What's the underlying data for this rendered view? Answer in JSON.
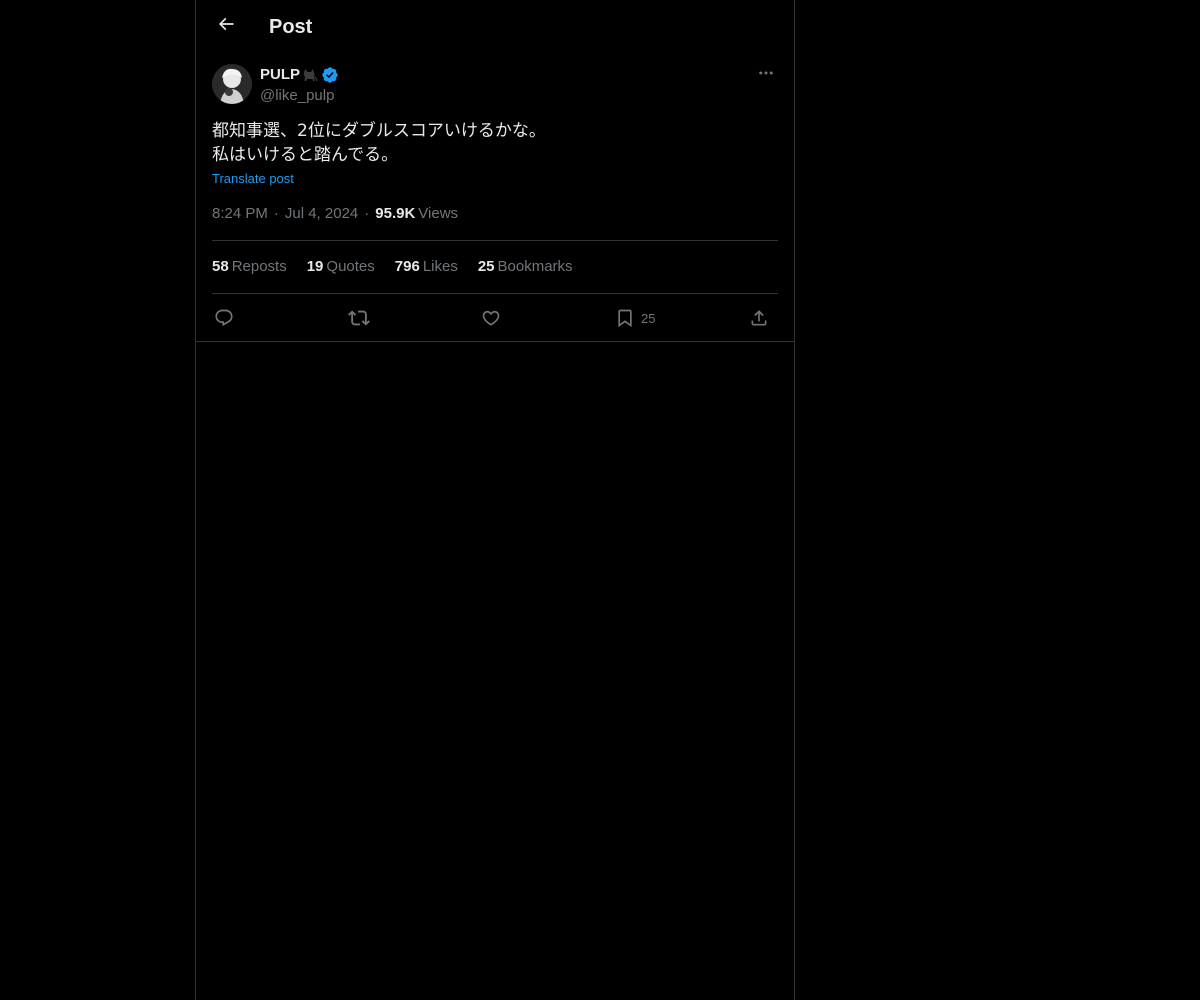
{
  "colors": {
    "background": "#000000",
    "text_primary": "#e7e9ea",
    "text_secondary": "#71767b",
    "accent": "#1d9bf0",
    "border": "#2f3336",
    "verified": "#1d9bf0"
  },
  "header": {
    "back_icon": "arrow-left-icon",
    "title": "Post"
  },
  "post": {
    "author": {
      "display_name": "PULP",
      "name_emoji_icon": "black-cat-icon",
      "verified_icon": "verified-badge-icon",
      "handle": "@like_pulp",
      "avatar_icon": "avatar-image"
    },
    "more_icon": "more-horizontal-icon",
    "text": "都知事選、2位にダブルスコアいけるかな。\n私はいけると踏んでる。",
    "translate_label": "Translate post",
    "time": "8:24 PM",
    "separator": "·",
    "date": "Jul 4, 2024",
    "views_count": "95.9K",
    "views_label": "Views"
  },
  "stats": [
    {
      "count": "58",
      "label": "Reposts"
    },
    {
      "count": "19",
      "label": "Quotes"
    },
    {
      "count": "796",
      "label": "Likes"
    },
    {
      "count": "25",
      "label": "Bookmarks"
    }
  ],
  "actions": {
    "reply_icon": "reply-icon",
    "repost_icon": "repost-icon",
    "like_icon": "heart-icon",
    "bookmark_icon": "bookmark-icon",
    "bookmark_count": "25",
    "share_icon": "share-icon"
  }
}
